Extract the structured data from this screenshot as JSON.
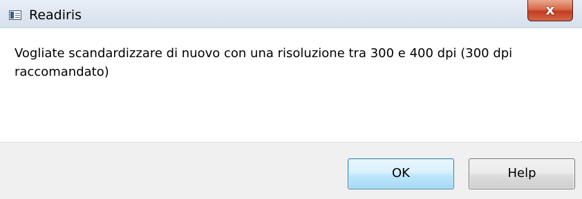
{
  "window": {
    "title": "Readiris",
    "close_label": "x"
  },
  "message": "Vogliate scandardizzare di nuovo con una risoluzione tra 300 e 400 dpi (300 dpi raccomandato)",
  "buttons": {
    "ok": "OK",
    "help": "Help"
  }
}
